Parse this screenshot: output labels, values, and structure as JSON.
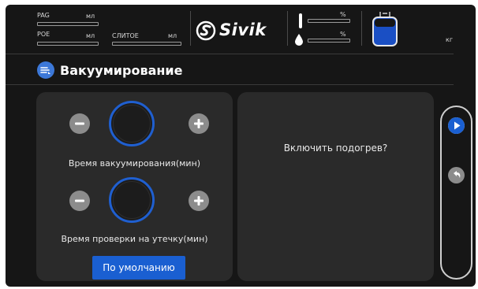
{
  "header": {
    "pag_label": "PAG",
    "pag_unit": "мл",
    "poe_label": "POE",
    "poe_unit": "мл",
    "drain_label": "СЛИТОЕ",
    "drain_unit": "мл",
    "brand": "Sivik",
    "pct_top_unit": "%",
    "pct_bottom_unit": "%",
    "weight_unit": "кг"
  },
  "page": {
    "title": "Вакуумирование"
  },
  "left_panel": {
    "vacuum_time_label": "Время вакуумирования(мин)",
    "leak_test_label": "Время проверки на утечку(мин)",
    "default_button": "По умолчанию"
  },
  "right_panel": {
    "question": "Включить подогрев?"
  },
  "icons": {
    "title": "vacuum-icon",
    "decrease": "minus-icon",
    "increase": "plus-icon",
    "play": "play-icon",
    "back": "back-arrow-icon",
    "tank": "tank-icon"
  },
  "colors": {
    "accent": "#1a5fd1",
    "background": "#161616",
    "panel": "#2a2a2a"
  }
}
